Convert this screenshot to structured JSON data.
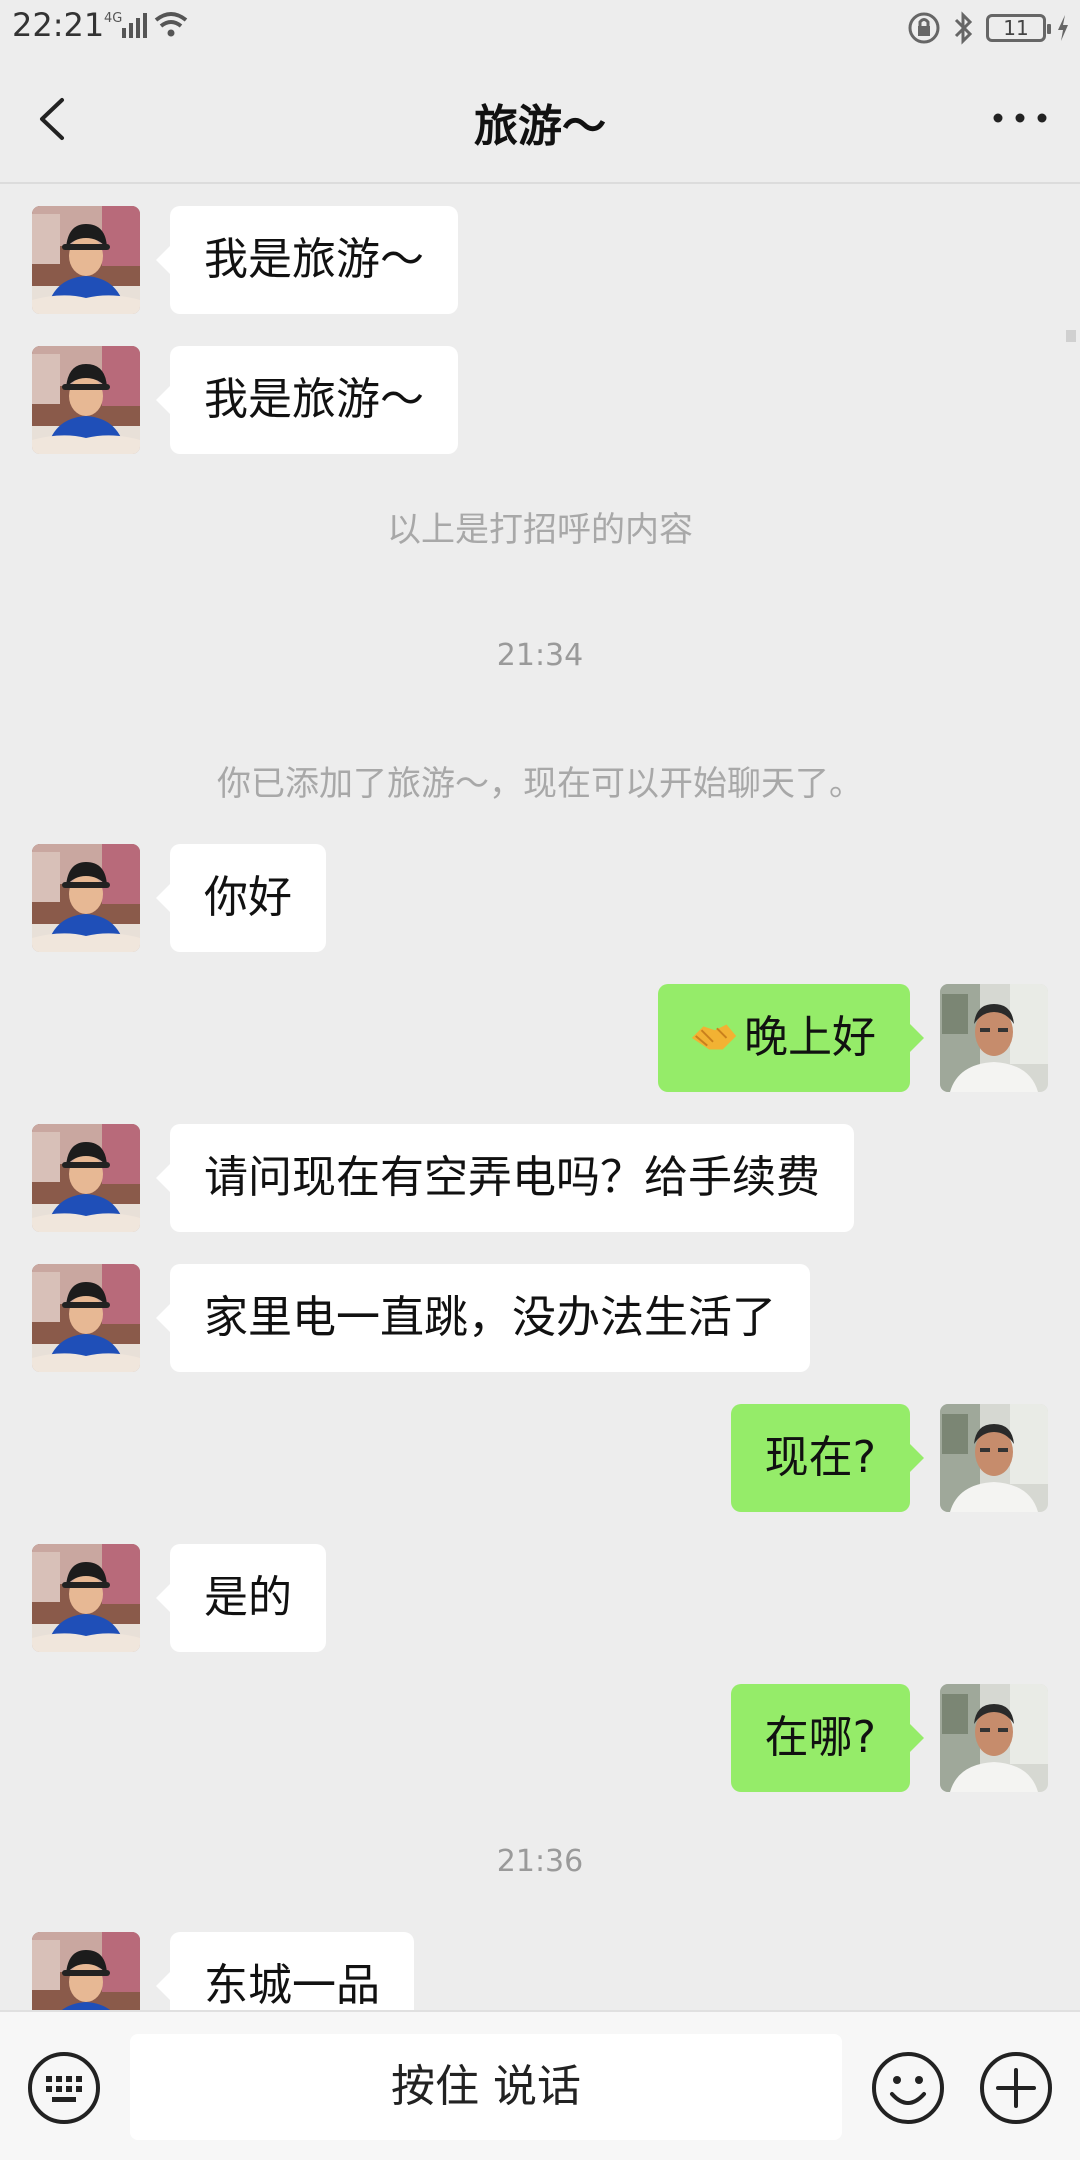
{
  "status_bar": {
    "time": "22:21",
    "network": "4G",
    "battery": "11"
  },
  "header": {
    "title": "旅游～"
  },
  "messages": [
    {
      "side": "in",
      "text": "我是旅游～"
    },
    {
      "side": "in",
      "text": "我是旅游～"
    },
    {
      "type": "system",
      "text": "以上是打招呼的内容"
    },
    {
      "type": "time",
      "text": "21:34"
    },
    {
      "type": "system",
      "text": "你已添加了旅游～，现在可以开始聊天了。"
    },
    {
      "side": "in",
      "text": "你好"
    },
    {
      "side": "out",
      "text": "晚上好",
      "emoji": "handshake-emoji"
    },
    {
      "side": "in",
      "text": "请问现在有空弄电吗？给手续费"
    },
    {
      "side": "in",
      "text": "家里电一直跳，没办法生活了"
    },
    {
      "side": "out",
      "text": "现在?"
    },
    {
      "side": "in",
      "text": "是的"
    },
    {
      "side": "out",
      "text": "在哪?"
    },
    {
      "type": "time",
      "text": "21:36"
    },
    {
      "side": "in",
      "text": "东城一品"
    }
  ],
  "input_bar": {
    "voice_button_label": "按住 说话"
  },
  "colors": {
    "background": "#ededed",
    "incoming_bubble": "#ffffff",
    "outgoing_bubble": "#95ec69",
    "system_text": "#a8a8a8"
  },
  "icons": [
    "back-icon",
    "more-icon",
    "keyboard-icon",
    "emoji-icon",
    "plus-icon"
  ]
}
